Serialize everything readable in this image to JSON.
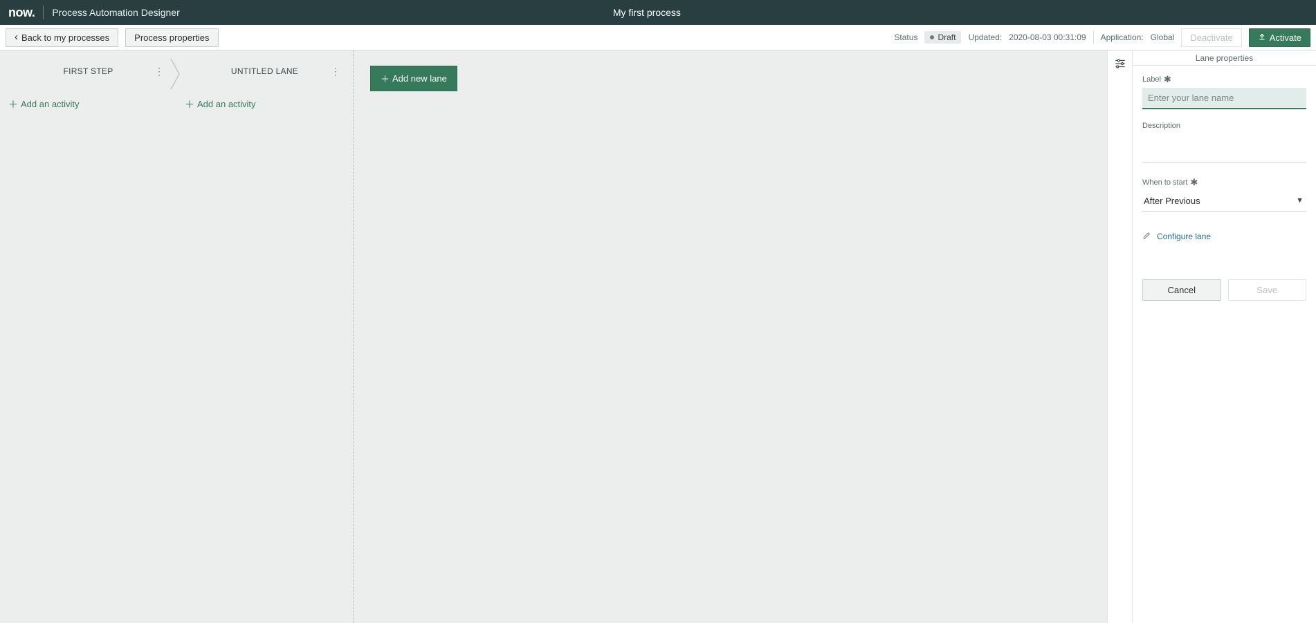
{
  "header": {
    "brand": "now.",
    "app_title": "Process Automation Designer",
    "process_name": "My first process"
  },
  "toolbar": {
    "back_label": "Back to my processes",
    "properties_label": "Process properties",
    "status_label": "Status",
    "status_value": "Draft",
    "updated_label": "Updated:",
    "updated_value": "2020-08-03 00:31:09",
    "application_label": "Application:",
    "application_value": "Global",
    "deactivate_label": "Deactivate",
    "activate_label": "Activate"
  },
  "canvas": {
    "lanes": [
      {
        "name": "FIRST STEP",
        "add_activity_label": "Add an activity"
      },
      {
        "name": "UNTITLED LANE",
        "add_activity_label": "Add an activity"
      }
    ],
    "add_lane_label": "Add new lane"
  },
  "side": {
    "panel_title": "Lane properties",
    "label_field": "Label",
    "label_placeholder": "Enter your lane name",
    "label_value": "",
    "description_field": "Description",
    "description_value": "",
    "when_field": "When to start",
    "when_value": "After Previous",
    "configure_link": "Configure lane",
    "cancel_label": "Cancel",
    "save_label": "Save"
  }
}
